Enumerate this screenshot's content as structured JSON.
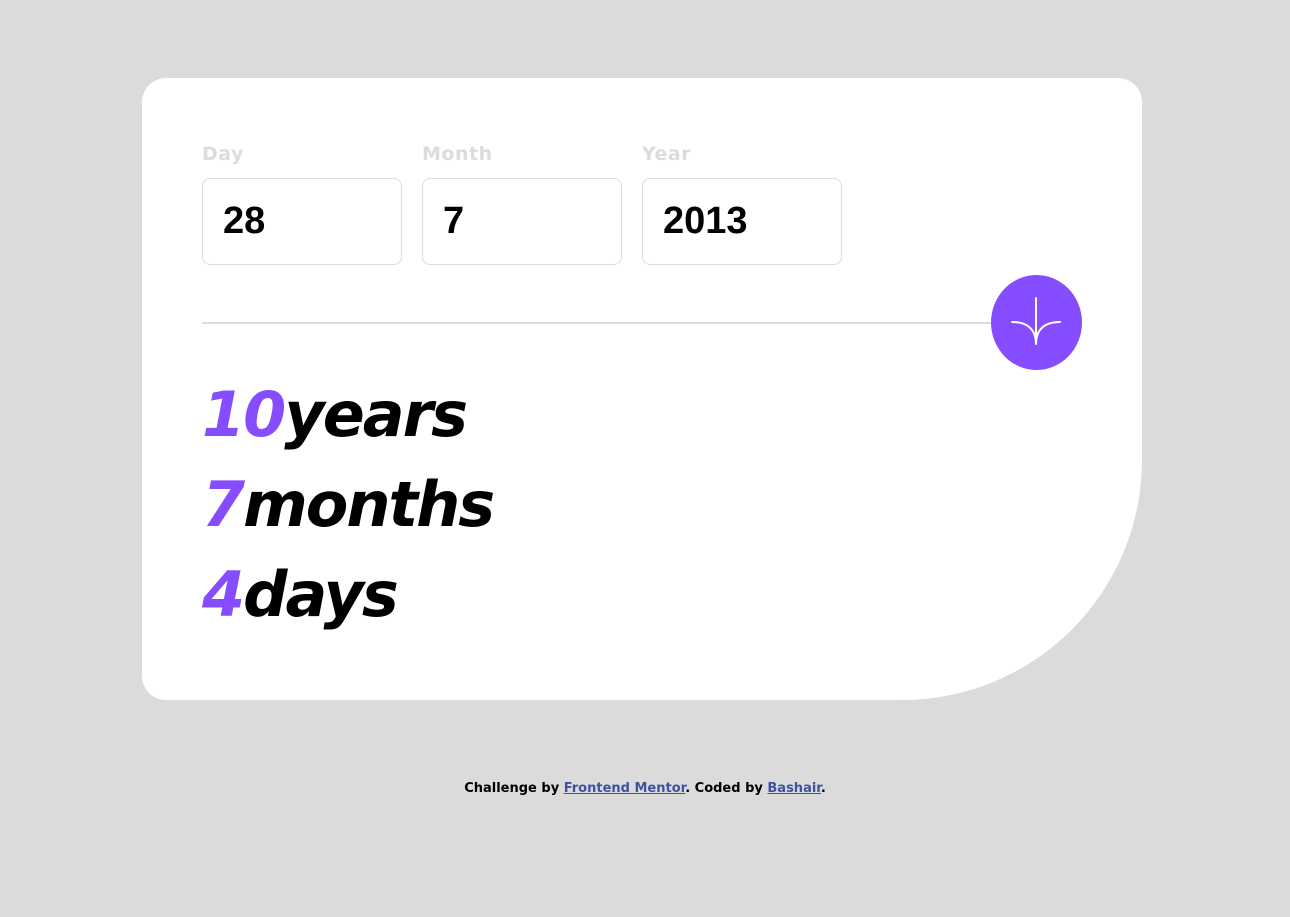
{
  "form": {
    "fields": [
      {
        "label": "Day",
        "value": "28"
      },
      {
        "label": "Month",
        "value": "7"
      },
      {
        "label": "Year",
        "value": "2013"
      }
    ],
    "submit_icon": "arrow-down-icon"
  },
  "results": [
    {
      "number": "10",
      "unit": "years"
    },
    {
      "number": "7",
      "unit": "months"
    },
    {
      "number": "4",
      "unit": "days"
    }
  ],
  "footer": {
    "prefix": "Challenge by ",
    "link1": "Frontend Mentor",
    "middle": ". Coded by ",
    "link2": "Bashair",
    "suffix": "."
  },
  "colors": {
    "accent": "#854dff",
    "background": "#dbdbdb",
    "card": "#ffffff",
    "label": "#dcdcdc",
    "link": "#3e52a3"
  }
}
